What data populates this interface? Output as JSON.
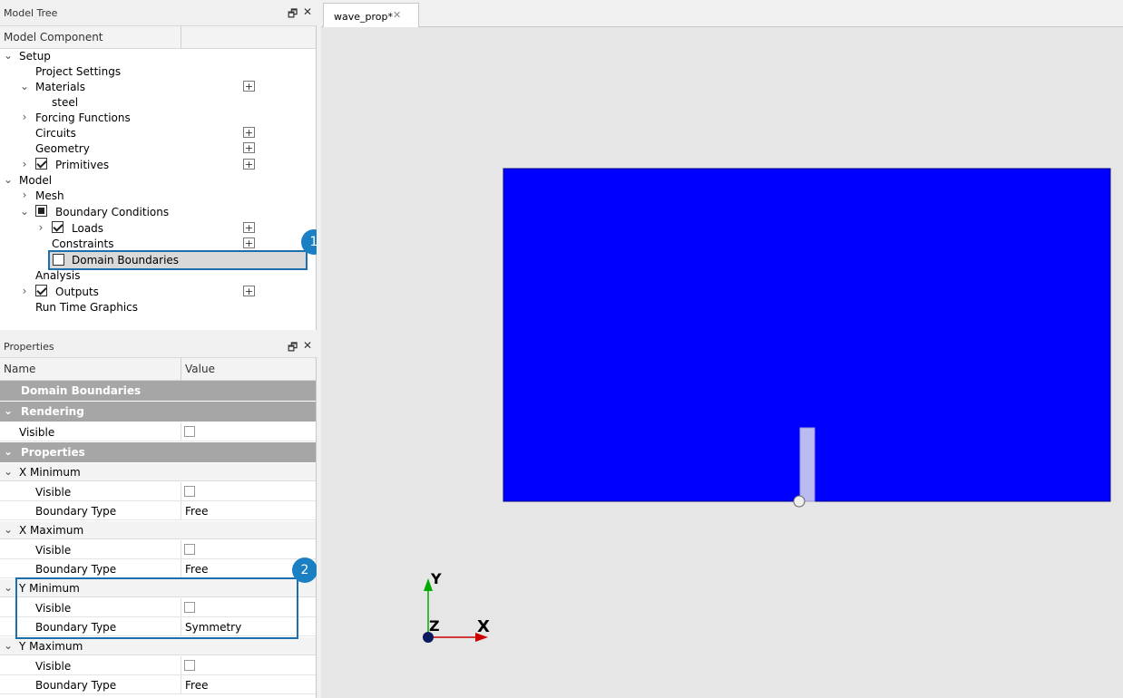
{
  "model_tree": {
    "title": "Model Tree",
    "column_header": "Model Component",
    "items": [
      {
        "label": "Setup"
      },
      {
        "label": "Project Settings"
      },
      {
        "label": "Materials"
      },
      {
        "label": "steel"
      },
      {
        "label": "Forcing Functions"
      },
      {
        "label": "Circuits"
      },
      {
        "label": "Geometry"
      },
      {
        "label": "Primitives"
      },
      {
        "label": "Model"
      },
      {
        "label": "Mesh"
      },
      {
        "label": "Boundary Conditions"
      },
      {
        "label": "Loads"
      },
      {
        "label": "Constraints"
      },
      {
        "label": "Domain Boundaries"
      },
      {
        "label": "Analysis"
      },
      {
        "label": "Outputs"
      },
      {
        "label": "Run Time Graphics"
      }
    ],
    "plus_label": "+"
  },
  "properties": {
    "title": "Properties",
    "col_name": "Name",
    "col_value": "Value",
    "header": "Domain Boundaries",
    "rendering": "Rendering",
    "visible": "Visible",
    "properties_section": "Properties",
    "x_min": "X Minimum",
    "x_max": "X Maximum",
    "y_min": "Y Minimum",
    "y_max": "Y Maximum",
    "boundary_type": "Boundary Type",
    "free": "Free",
    "symmetry": "Symmetry"
  },
  "tab": {
    "label": "wave_prop*",
    "close": "✕"
  },
  "icons": {
    "restore": "🗗",
    "close": "✕"
  },
  "badges": {
    "one": "1",
    "two": "2"
  },
  "axes": {
    "y": "Y",
    "z": "Z",
    "x": "X"
  },
  "colors": {
    "domain": "#0000ff",
    "primitive": "#bbbbf2",
    "badge": "#1b7fc4",
    "x_axis": "#cc0000",
    "y_axis": "#00aa00",
    "z_axis": "#0a1a5c"
  }
}
